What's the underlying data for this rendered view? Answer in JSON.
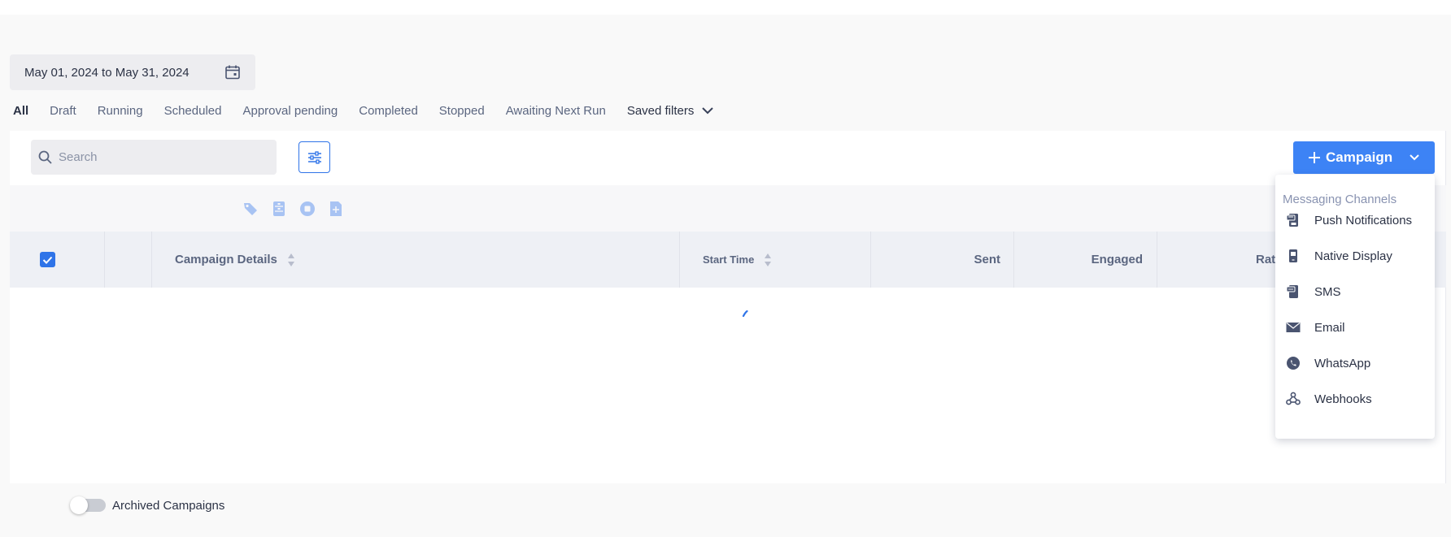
{
  "date_range": {
    "label": "May 01, 2024 to May 31, 2024",
    "icon": "calendar-icon"
  },
  "tabs": [
    {
      "label": "All",
      "active": true
    },
    {
      "label": "Draft"
    },
    {
      "label": "Running"
    },
    {
      "label": "Scheduled"
    },
    {
      "label": "Approval pending"
    },
    {
      "label": "Completed"
    },
    {
      "label": "Stopped"
    },
    {
      "label": "Awaiting Next Run"
    },
    {
      "label": "Saved filters",
      "icon": "chevron-down-icon"
    }
  ],
  "search": {
    "placeholder": "Search",
    "value": ""
  },
  "toolbar_icons": [
    "tag-icon",
    "archive-icon",
    "stop-icon",
    "duplicate-icon"
  ],
  "table": {
    "columns": {
      "campaign_details": "Campaign Details",
      "start_time": "Start Time",
      "sent": "Sent",
      "engaged": "Engaged",
      "rate": "Rate"
    },
    "select_all_checked": true,
    "loading": true
  },
  "campaign_button": {
    "label": "Campaign"
  },
  "dropdown": {
    "heading": "Messaging Channels",
    "items": [
      {
        "label": "Push Notifications",
        "icon": "push-notification-icon"
      },
      {
        "label": "Native Display",
        "icon": "native-display-icon"
      },
      {
        "label": "SMS",
        "icon": "sms-icon"
      },
      {
        "label": "Email",
        "icon": "email-icon"
      },
      {
        "label": "WhatsApp",
        "icon": "whatsapp-icon"
      },
      {
        "label": "Webhooks",
        "icon": "webhooks-icon"
      }
    ]
  },
  "archived_toggle": {
    "label": "Archived Campaigns",
    "on": false
  },
  "colors": {
    "accent": "#3d83f5",
    "text_dark": "#2b3245",
    "text_muted": "#5b6680",
    "icon_muted": "#a8c3f3"
  }
}
